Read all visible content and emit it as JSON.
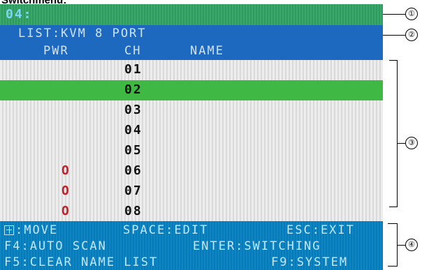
{
  "page_title": "Switchmenu:",
  "screen": {
    "cursor_text": "04:",
    "title": "LIST:KVM 8 PORT",
    "headers": {
      "pwr": "PWR",
      "ch": "CH",
      "name": "NAME"
    },
    "rows": [
      {
        "ch": "01",
        "pwr": "",
        "selected": false
      },
      {
        "ch": "02",
        "pwr": "",
        "selected": true
      },
      {
        "ch": "03",
        "pwr": "",
        "selected": false
      },
      {
        "ch": "04",
        "pwr": "",
        "selected": false
      },
      {
        "ch": "05",
        "pwr": "",
        "selected": false
      },
      {
        "ch": "06",
        "pwr": "O",
        "selected": false
      },
      {
        "ch": "07",
        "pwr": "O",
        "selected": false
      },
      {
        "ch": "08",
        "pwr": "O",
        "selected": false
      }
    ],
    "footer": {
      "move": ":MOVE",
      "space_edit": "SPACE:EDIT",
      "esc_exit": "ESC:EXIT",
      "auto_scan": "F4:AUTO SCAN",
      "enter_switching": "ENTER:SWITCHING",
      "clear_name_list": "F5:CLEAR NAME LIST",
      "system": "F9:SYSTEM"
    }
  },
  "callouts": [
    "①",
    "②",
    "③",
    "④"
  ],
  "icons": {
    "move": "up-down-arrow-box-icon"
  },
  "colors": {
    "selected_row": "#3fb944",
    "power_indicator": "#c8202a",
    "title_bar": "#1d69bf",
    "footer": "#0c86c4"
  }
}
